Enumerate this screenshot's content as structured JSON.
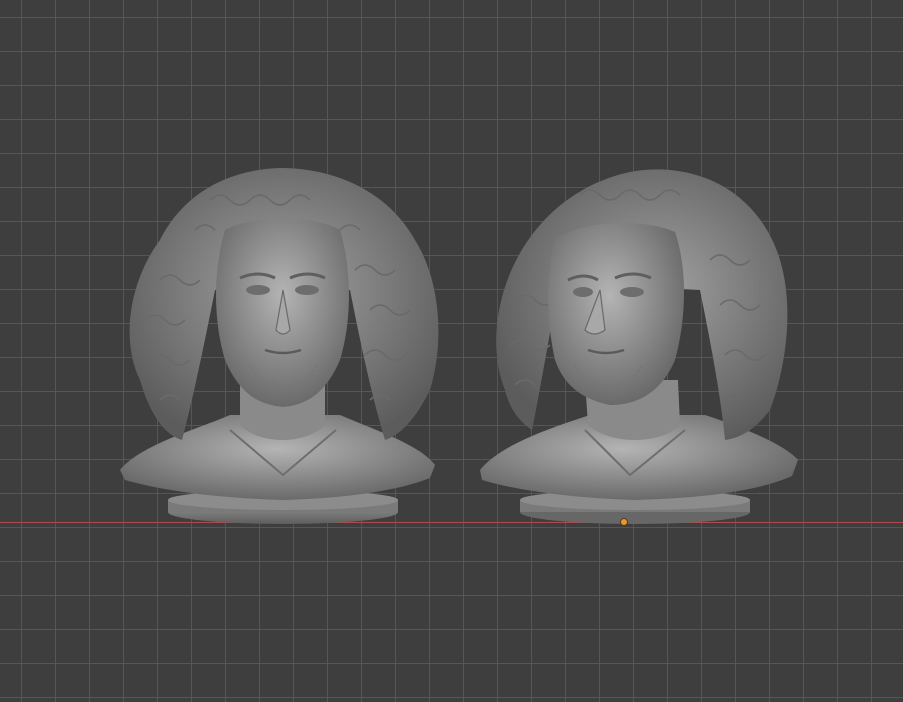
{
  "viewport": {
    "background": "#3e3e3e",
    "grid_color": "#5a5a5a",
    "x_axis_color": "#b04a4e",
    "origin_color": "#e59a2f"
  },
  "objects": [
    {
      "name": "bust-front",
      "view": "front",
      "material_color": "#8f8f8f"
    },
    {
      "name": "bust-three-quarter",
      "view": "three-quarter",
      "material_color": "#8f8f8f"
    }
  ]
}
